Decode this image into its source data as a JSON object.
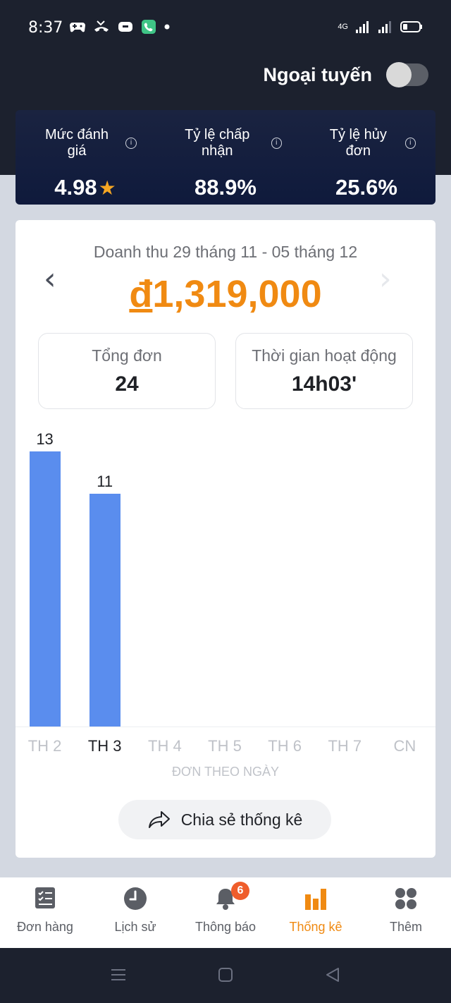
{
  "status_bar": {
    "time": "8:37",
    "network": "4G"
  },
  "header": {
    "offline_label": "Ngoại tuyến",
    "offline_enabled": false
  },
  "metrics": [
    {
      "label": "Mức đánh giá",
      "value": "4.98",
      "has_star": true
    },
    {
      "label": "Tỷ lệ chấp nhận",
      "value": "88.9%"
    },
    {
      "label": "Tỷ lệ hủy đơn",
      "value": "25.6%"
    }
  ],
  "stats": {
    "period": "Doanh thu 29 tháng 11 - 05 tháng 12",
    "currency_symbol": "đ",
    "revenue": "1,319,000",
    "total_orders_label": "Tổng đơn",
    "total_orders_value": "24",
    "active_time_label": "Thời gian hoạt động",
    "active_time_value": "14h03'"
  },
  "chart_data": {
    "type": "bar",
    "categories": [
      "TH 2",
      "TH 3",
      "TH 4",
      "TH 5",
      "TH 6",
      "TH 7",
      "CN"
    ],
    "values": [
      13,
      11,
      0,
      0,
      0,
      0,
      0
    ],
    "value_labels": [
      "13",
      "11",
      "",
      "",
      "",
      "",
      ""
    ],
    "active_category": "TH 3",
    "xlabel": "ĐƠN THEO NGÀY",
    "ylabel": "",
    "ylim": [
      0,
      13
    ],
    "bar_color": "#5a8dee",
    "grid": false
  },
  "share_button": {
    "label": "Chia sẻ thống kê"
  },
  "bottom_nav": [
    {
      "label": "Đơn hàng",
      "icon": "orders-icon"
    },
    {
      "label": "Lịch sử",
      "icon": "clock-icon"
    },
    {
      "label": "Thông báo",
      "icon": "bell-icon",
      "badge": "6"
    },
    {
      "label": "Thống kê",
      "icon": "bar-chart-icon",
      "active": true
    },
    {
      "label": "Thêm",
      "icon": "grid-icon"
    }
  ],
  "colors": {
    "accent": "#f08a12",
    "dark_bg": "#1c212e",
    "bar": "#5a8dee",
    "badge": "#ef5d2b"
  }
}
